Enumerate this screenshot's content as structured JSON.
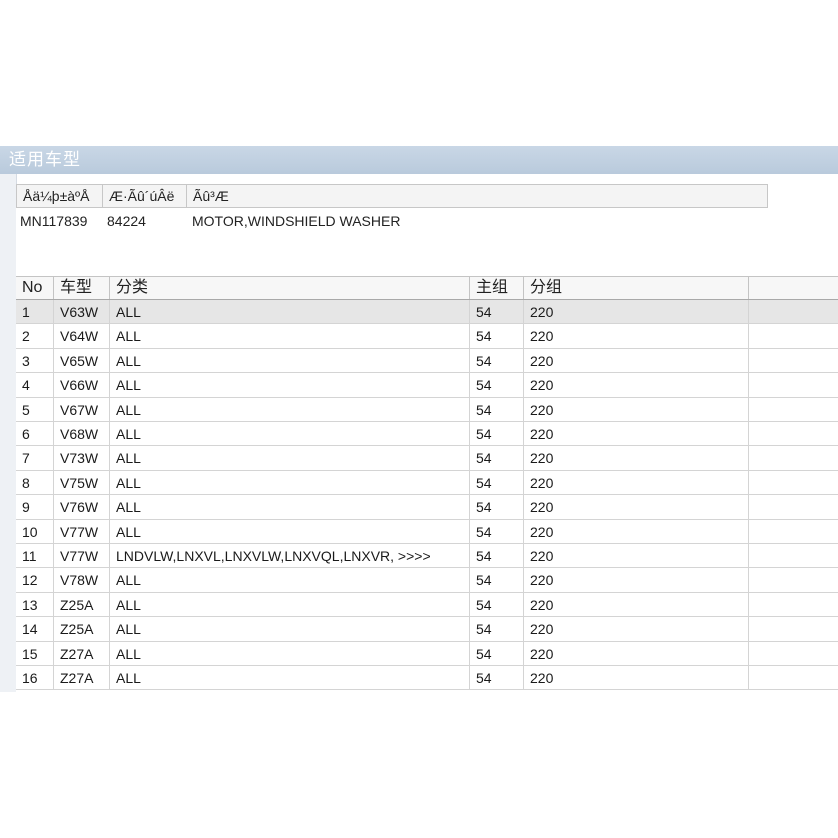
{
  "window": {
    "title": "适用车型"
  },
  "info": {
    "headers": [
      "Åä¼þ±àºÅ",
      "Æ·Ãû´úÂë",
      "Ãû³Æ"
    ],
    "values": [
      "MN117839",
      "84224",
      "MOTOR,WINDSHIELD WASHER"
    ]
  },
  "grid": {
    "headers": [
      "No",
      "车型",
      "分类",
      "主组",
      "分组"
    ],
    "rows": [
      {
        "no": "1",
        "model": "V63W",
        "category": "ALL",
        "main_group": "54",
        "sub_group": "220"
      },
      {
        "no": "2",
        "model": "V64W",
        "category": "ALL",
        "main_group": "54",
        "sub_group": "220"
      },
      {
        "no": "3",
        "model": "V65W",
        "category": "ALL",
        "main_group": "54",
        "sub_group": "220"
      },
      {
        "no": "4",
        "model": "V66W",
        "category": "ALL",
        "main_group": "54",
        "sub_group": "220"
      },
      {
        "no": "5",
        "model": "V67W",
        "category": "ALL",
        "main_group": "54",
        "sub_group": "220"
      },
      {
        "no": "6",
        "model": "V68W",
        "category": "ALL",
        "main_group": "54",
        "sub_group": "220"
      },
      {
        "no": "7",
        "model": "V73W",
        "category": "ALL",
        "main_group": "54",
        "sub_group": "220"
      },
      {
        "no": "8",
        "model": "V75W",
        "category": "ALL",
        "main_group": "54",
        "sub_group": "220"
      },
      {
        "no": "9",
        "model": "V76W",
        "category": "ALL",
        "main_group": "54",
        "sub_group": "220"
      },
      {
        "no": "10",
        "model": "V77W",
        "category": "ALL",
        "main_group": "54",
        "sub_group": "220"
      },
      {
        "no": "11",
        "model": "V77W",
        "category": "LNDVLW,LNXVL,LNXVLW,LNXVQL,LNXVR,  >>>>",
        "main_group": "54",
        "sub_group": "220"
      },
      {
        "no": "12",
        "model": "V78W",
        "category": "ALL",
        "main_group": "54",
        "sub_group": "220"
      },
      {
        "no": "13",
        "model": "Z25A",
        "category": "ALL",
        "main_group": "54",
        "sub_group": "220"
      },
      {
        "no": "14",
        "model": "Z25A",
        "category": "ALL",
        "main_group": "54",
        "sub_group": "220"
      },
      {
        "no": "15",
        "model": "Z27A",
        "category": "ALL",
        "main_group": "54",
        "sub_group": "220"
      },
      {
        "no": "16",
        "model": "Z27A",
        "category": "ALL",
        "main_group": "54",
        "sub_group": "220"
      }
    ],
    "selected_row_index": 0
  }
}
